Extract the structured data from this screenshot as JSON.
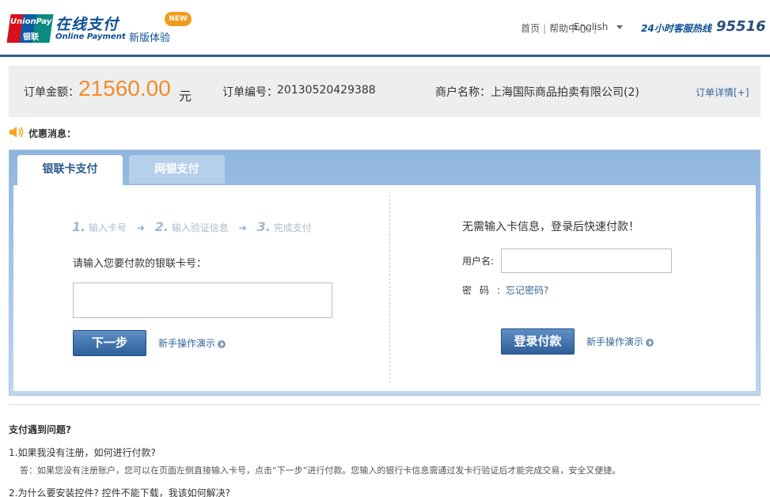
{
  "header": {
    "logo_text_en": "UnionPay",
    "logo_text_cn": "银联",
    "brand_cn": "在线支付",
    "brand_en": "Online Payment",
    "new_version": "新版体验",
    "new_badge": "NEW",
    "nav": [
      "首页",
      "帮助中心"
    ],
    "language": "English",
    "hotline_label": "24小时客服热线",
    "hotline_number": "95516"
  },
  "order": {
    "amount_label": "订单金额：",
    "amount": "21560.00",
    "currency": "元",
    "number_label": "订单编号：",
    "number": "20130520429388",
    "merchant_label": "商户名称：",
    "merchant": "上海国际商品拍卖有限公司(2)",
    "detail_link": "订单详情[+]"
  },
  "promo": {
    "label": "优惠消息："
  },
  "tabs": [
    {
      "label": "银联卡支付",
      "active": true
    },
    {
      "label": "网银支付",
      "active": false
    }
  ],
  "card_pay": {
    "steps": [
      {
        "num": "1.",
        "label": "输入卡号"
      },
      {
        "num": "2.",
        "label": "输入验证信息"
      },
      {
        "num": "3.",
        "label": "完成支付"
      }
    ],
    "prompt": "请输入您要付款的银联卡号：",
    "card_input_value": "",
    "next_button": "下一步",
    "demo_link": "新手操作演示"
  },
  "login_pay": {
    "title": "无需输入卡信息，登录后快速付款！",
    "username_label": "用户名:",
    "username_value": "",
    "password_label": "密码:",
    "forgot_link": "忘记密码?",
    "login_button": "登录付款",
    "demo_link": "新手操作演示"
  },
  "faq": {
    "title": "支付遇到问题?",
    "items": [
      {
        "q": "1.如果我没有注册，如何进行付款?",
        "a": "答：如果您没有注册账户，您可以在页面左侧直接输入卡号，点击“下一步”进行付款。您输入的银行卡信息需通过发卡行验证后才能完成交易，安全又便捷。"
      },
      {
        "q": "2.为什么要安装控件? 控件不能下载，我该如何解决?"
      }
    ]
  },
  "colors": {
    "brand_blue": "#2f5b8f",
    "amount_orange": "#f08c2a",
    "link_blue": "#336699"
  }
}
